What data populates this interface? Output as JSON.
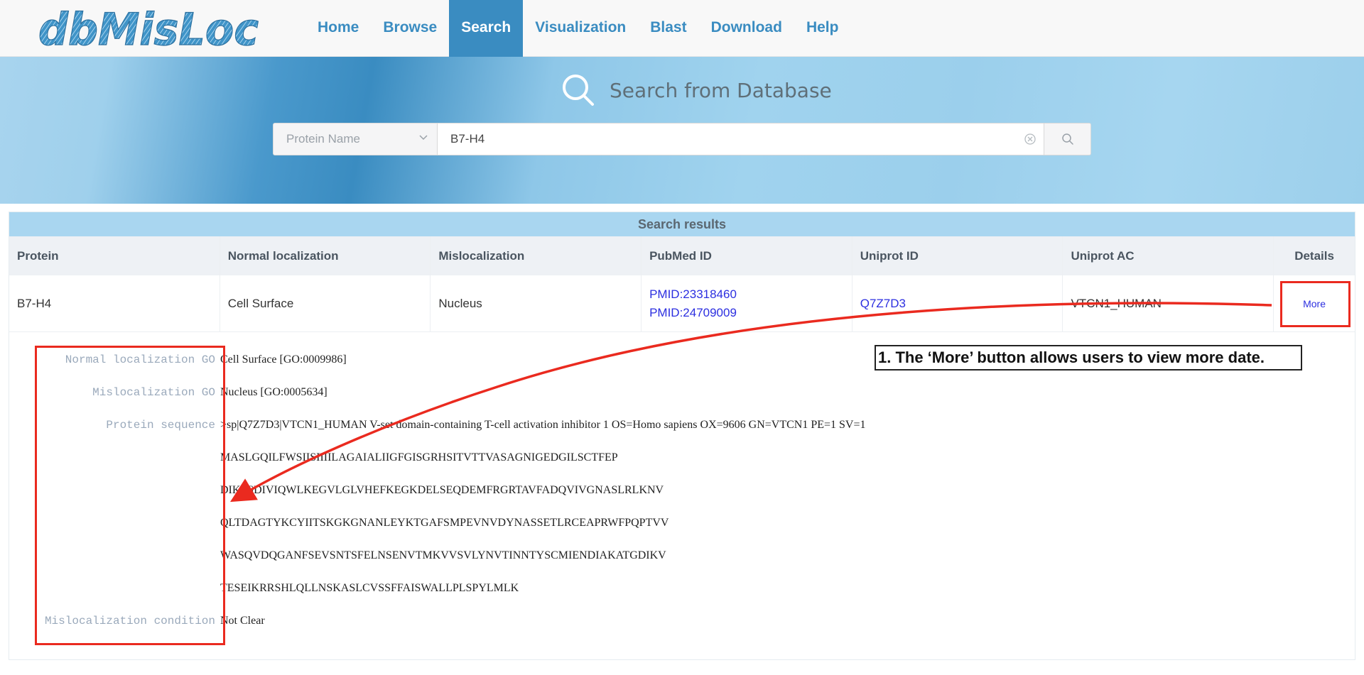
{
  "brand": {
    "logo_text": "dbMisLoc"
  },
  "nav": {
    "items": [
      {
        "label": "Home"
      },
      {
        "label": "Browse"
      },
      {
        "label": "Search"
      },
      {
        "label": "Visualization"
      },
      {
        "label": "Blast"
      },
      {
        "label": "Download"
      },
      {
        "label": "Help"
      }
    ],
    "active": "Search"
  },
  "hero": {
    "title": "Search from Database",
    "select_value": "Protein Name",
    "input_value": "B7-H4"
  },
  "results": {
    "title": "Search results",
    "columns": [
      "Protein",
      "Normal localization",
      "Mislocalization",
      "PubMed ID",
      "Uniprot ID",
      "Uniprot AC",
      "Details"
    ],
    "rows": [
      {
        "protein": "B7-H4",
        "normal_localization": "Cell Surface",
        "mislocalization": "Nucleus",
        "pubmed_ids": [
          "PMID:23318460",
          "PMID:24709009"
        ],
        "uniprot_id": "Q7Z7D3",
        "uniprot_ac": "VTCN1_HUMAN",
        "details_label": "More"
      }
    ]
  },
  "detail": {
    "normal_go_label": "Normal localization GO",
    "normal_go_value": "Cell Surface [GO:0009986]",
    "mis_go_label": "Mislocalization GO",
    "mis_go_value": "Nucleus [GO:0005634]",
    "sequence_label": "Protein sequence",
    "sequence_header": ">sp|Q7Z7D3|VTCN1_HUMAN V-set domain-containing T-cell activation inhibitor 1 OS=Homo sapiens OX=9606 GN=VTCN1 PE=1 SV=1",
    "sequence_lines": [
      "MASLGQILFWSIISIIIILAGAIALIIGFGISGRHSITVTTVASAGNIGEDGILSCTFEP",
      "DIKLSDIVIQWLKEGVLGLVHEFKEGKDELSEQDEMFRGRTAVFADQVIVGNASLRLKNV",
      "QLTDAGTYKCYIITSKGKGNANLEYKTGAFSMPEVNVDYNASSETLRCEAPRWFPQPTVV",
      "WASQVDQGANFSEVSNTSFELNSENVTMKVVSVLYNVTINNTYSCMIENDIAKATGDIKV",
      "TESEIKRRSHLQLLNSKASLCVSSFFAISWALLPLSPYLMLK"
    ],
    "condition_label": "Mislocalization condition",
    "condition_value": "Not Clear"
  },
  "annotation": {
    "note": "1. The ‘More’ button allows users to view more date.",
    "color": "#ea2a1f"
  }
}
